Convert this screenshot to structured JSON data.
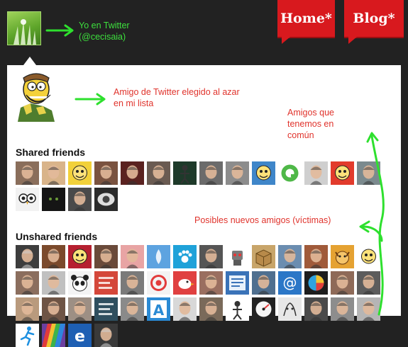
{
  "header": {
    "me_note_line1": "Yo en Twitter",
    "me_note_line2": "(@cecisaia)",
    "nav": [
      {
        "label": "Home*"
      },
      {
        "label": "Blog*"
      }
    ]
  },
  "panel": {
    "random_note_line1": "Amigo de Twitter elegido al azar",
    "random_note_line2": "en mi lista",
    "common_note_line1": "Amigos que",
    "common_note_line2": "tenemos en",
    "common_note_line3": "común",
    "new_note": "Posibles nuevos amigos (víctimas)",
    "shared_title": "Shared friends",
    "unshared_title": "Unshared friends"
  },
  "shared_friends": [
    {
      "color": "#8a6e5b",
      "icon": "face"
    },
    {
      "color": "#d9b48a",
      "icon": "face"
    },
    {
      "color": "#f2d13a",
      "icon": "cartoon"
    },
    {
      "color": "#7a5340",
      "icon": "face"
    },
    {
      "color": "#5a2220",
      "icon": "face"
    },
    {
      "color": "#6a5b52",
      "icon": "face"
    },
    {
      "color": "#1e3a2a",
      "icon": "figure"
    },
    {
      "color": "#6b6b6b",
      "icon": "face"
    },
    {
      "color": "#8c8c8c",
      "icon": "face"
    },
    {
      "color": "#3f86c9",
      "icon": "cartoon"
    },
    {
      "color": "#ffffff",
      "icon": "logo-q"
    },
    {
      "color": "#cfcfcf",
      "icon": "face"
    },
    {
      "color": "#e23b2c",
      "icon": "cartoon"
    },
    {
      "color": "#7b8a8e",
      "icon": "face"
    },
    {
      "color": "#f2f2f2",
      "icon": "owl"
    },
    {
      "color": "#151515",
      "icon": "dark"
    },
    {
      "color": "#4a4a4a",
      "icon": "face"
    },
    {
      "color": "#2a2a2a",
      "icon": "eye"
    }
  ],
  "unshared_friends": [
    {
      "color": "#3d3d3d",
      "icon": "face"
    },
    {
      "color": "#7b4a2c",
      "icon": "face"
    },
    {
      "color": "#b62030",
      "icon": "cartoon"
    },
    {
      "color": "#6a4a3a",
      "icon": "face"
    },
    {
      "color": "#e8a4a4",
      "icon": "face"
    },
    {
      "color": "#5da3e0",
      "icon": "drop"
    },
    {
      "color": "#1fa2d9",
      "icon": "paw"
    },
    {
      "color": "#555555",
      "icon": "face"
    },
    {
      "color": "#ffffff",
      "icon": "robot"
    },
    {
      "color": "#c8a56a",
      "icon": "box"
    },
    {
      "color": "#6b8db0",
      "icon": "face"
    },
    {
      "color": "#a05a3a",
      "icon": "face"
    },
    {
      "color": "#e5a232",
      "icon": "dog"
    },
    {
      "color": "#ffffff",
      "icon": "cartoon"
    },
    {
      "color": "#8b6e5e",
      "icon": "face"
    },
    {
      "color": "#c0c0c0",
      "icon": "face"
    },
    {
      "color": "#f4f4f4",
      "icon": "panda"
    },
    {
      "color": "#d4473a",
      "icon": "text"
    },
    {
      "color": "#7a7a7a",
      "icon": "face"
    },
    {
      "color": "#f3f3f3",
      "icon": "ring"
    },
    {
      "color": "#e04040",
      "icon": "bird"
    },
    {
      "color": "#9a6f60",
      "icon": "face"
    },
    {
      "color": "#3a73b8",
      "icon": "lines"
    },
    {
      "color": "#4f6f8f",
      "icon": "face"
    },
    {
      "color": "#2b77c7",
      "icon": "at"
    },
    {
      "color": "#1d1d1d",
      "icon": "pie"
    },
    {
      "color": "#8e6a58",
      "icon": "face"
    },
    {
      "color": "#5c5c5c",
      "icon": "face"
    },
    {
      "color": "#b99a7d",
      "icon": "face"
    },
    {
      "color": "#6e5445",
      "icon": "face"
    },
    {
      "color": "#9d8f84",
      "icon": "face"
    },
    {
      "color": "#2f4f5f",
      "icon": "text"
    },
    {
      "color": "#8a8a8a",
      "icon": "face"
    },
    {
      "color": "#2a8ad4",
      "icon": "letter-a"
    },
    {
      "color": "#d8d8d8",
      "icon": "face"
    },
    {
      "color": "#7a6a5a",
      "icon": "face"
    },
    {
      "color": "#ffffff",
      "icon": "figure"
    },
    {
      "color": "#222222",
      "icon": "gauge"
    },
    {
      "color": "#e7e7e7",
      "icon": "sketch"
    },
    {
      "color": "#4a4a4a",
      "icon": "face"
    },
    {
      "color": "#8d8d8d",
      "icon": "face"
    },
    {
      "color": "#b5b5b5",
      "icon": "face"
    },
    {
      "color": "#ffffff",
      "icon": "runner"
    },
    {
      "color": "#6b3fa0",
      "icon": "rainbow"
    },
    {
      "color": "#1e5fb3",
      "icon": "letter-e"
    },
    {
      "color": "#3a3a3a",
      "icon": "face"
    }
  ]
}
